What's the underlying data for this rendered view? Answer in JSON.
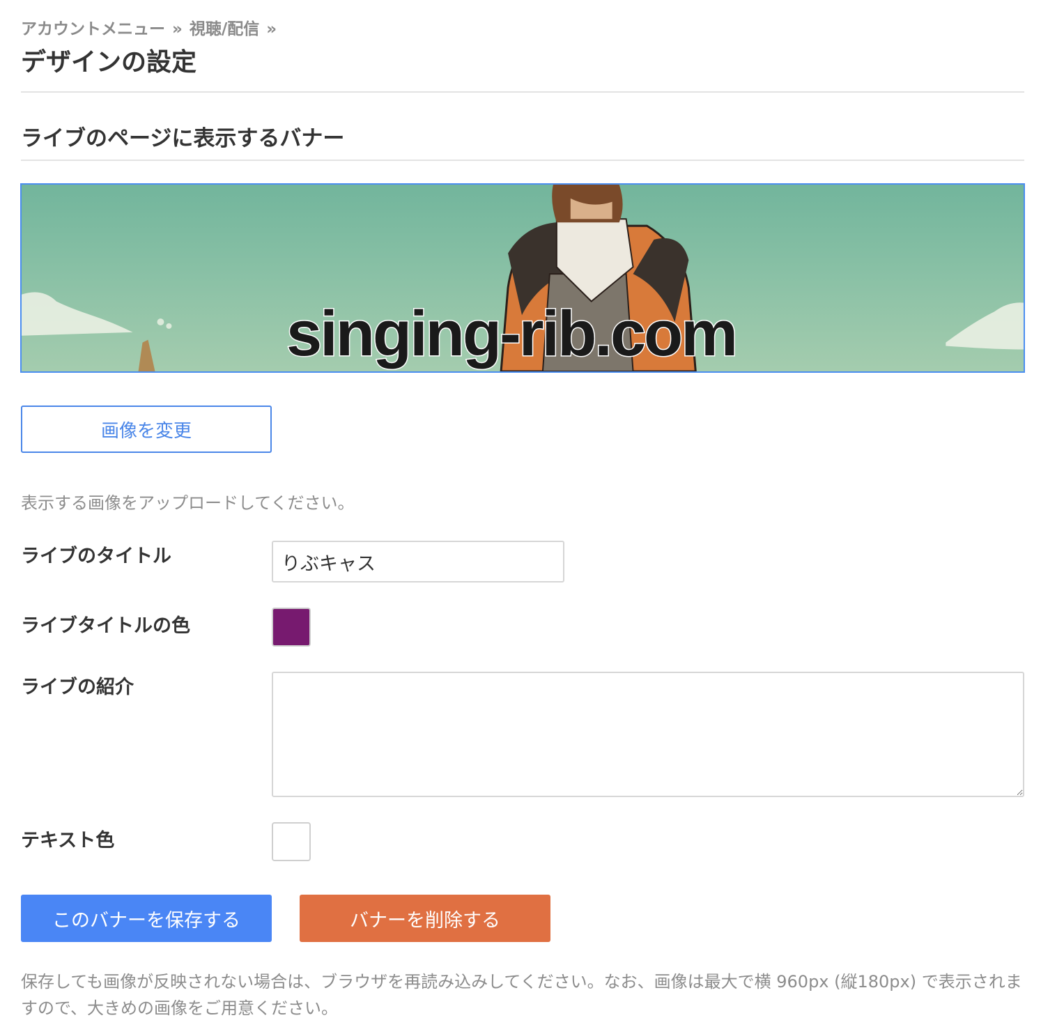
{
  "breadcrumb": {
    "items": [
      "アカウントメニュー",
      "視聴/配信"
    ],
    "separator": "»"
  },
  "page_title": "デザインの設定",
  "section_title": "ライブのページに表示するバナー",
  "banner": {
    "overlay_text": "singing-rib.com",
    "sky_color": "#7ab9a0"
  },
  "buttons": {
    "change_image": "画像を変更",
    "save": "このバナーを保存する",
    "delete": "バナーを削除する"
  },
  "hint": "表示する画像をアップロードしてください。",
  "form": {
    "live_title_label": "ライブのタイトル",
    "live_title_value": "りぶキャス",
    "live_title_color_label": "ライブタイトルの色",
    "live_title_color": "#771a6f",
    "live_intro_label": "ライブの紹介",
    "live_intro_value": "",
    "text_color_label": "テキスト色",
    "text_color": "#ffffff"
  },
  "colors": {
    "accent": "#4a86e8",
    "danger": "#e07042"
  },
  "footnote": "保存しても画像が反映されない場合は、ブラウザを再読み込みしてください。なお、画像は最大で横 960px (縦180px) で表示されますので、大きめの画像をご用意ください。"
}
